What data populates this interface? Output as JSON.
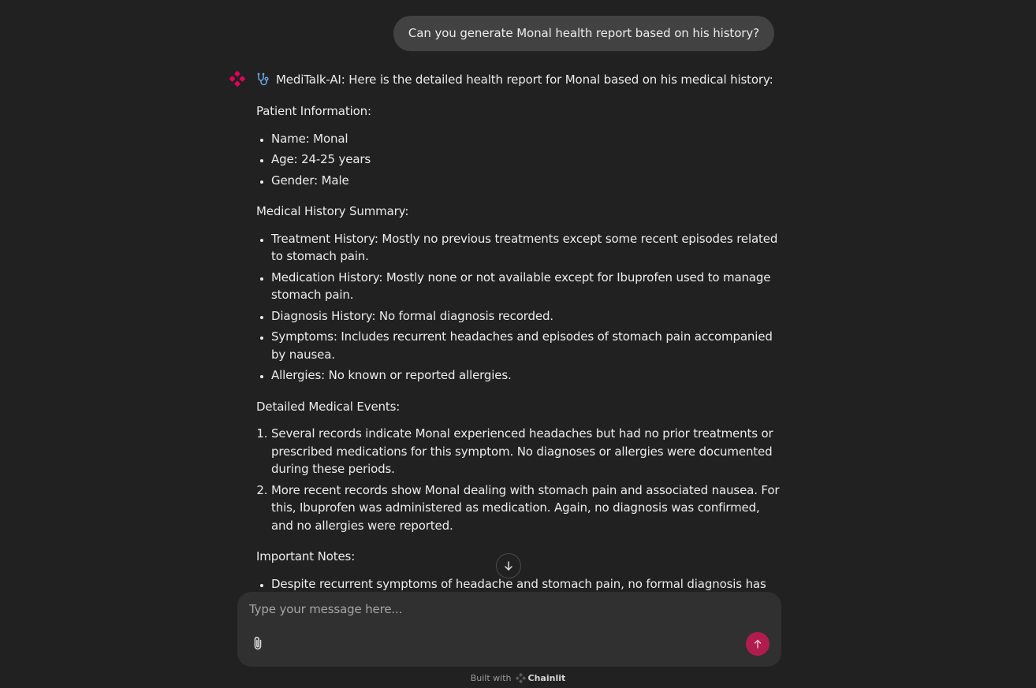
{
  "user_message": "Can you generate Monal health report based on his history?",
  "bot": {
    "name_prefix": "MediTalk-AI:",
    "intro": "Here is the detailed health report for Monal based on his medical history:",
    "patient_info": {
      "heading": "Patient Information:",
      "items": [
        "Name: Monal",
        "Age: 24-25 years",
        "Gender: Male"
      ]
    },
    "history_summary": {
      "heading": "Medical History Summary:",
      "items": [
        "Treatment History: Mostly no previous treatments except some recent episodes related to stomach pain.",
        "Medication History: Mostly none or not available except for Ibuprofen used to manage stomach pain.",
        "Diagnosis History: No formal diagnosis recorded.",
        "Symptoms: Includes recurrent headaches and episodes of stomach pain accompanied by nausea.",
        "Allergies: No known or reported allergies."
      ]
    },
    "medical_events": {
      "heading": "Detailed Medical Events:",
      "items": [
        "Several records indicate Monal experienced headaches but had no prior treatments or prescribed medications for this symptom. No diagnoses or allergies were documented during these periods.",
        "More recent records show Monal dealing with stomach pain and associated nausea. For this, Ibuprofen was administered as medication. Again, no diagnosis was confirmed, and no allergies were reported."
      ]
    },
    "notes": {
      "heading": "Important Notes:",
      "items": [
        "Despite recurrent symptoms of headache and stomach pain, no formal diagnosis has"
      ]
    }
  },
  "composer": {
    "placeholder": "Type your message here..."
  },
  "footer": {
    "built_with": "Built with",
    "brand": "Chainlit"
  },
  "icons": {
    "avatar": "chainlit-logo-icon",
    "stethoscope": "stethoscope-icon",
    "scroll": "arrow-down-icon",
    "attach": "paperclip-icon",
    "send": "arrow-up-icon"
  },
  "colors": {
    "background": "#212121",
    "user_bubble": "#424242",
    "composer": "#303030",
    "accent": "#e6005c",
    "send_button": "#b01c4d"
  }
}
